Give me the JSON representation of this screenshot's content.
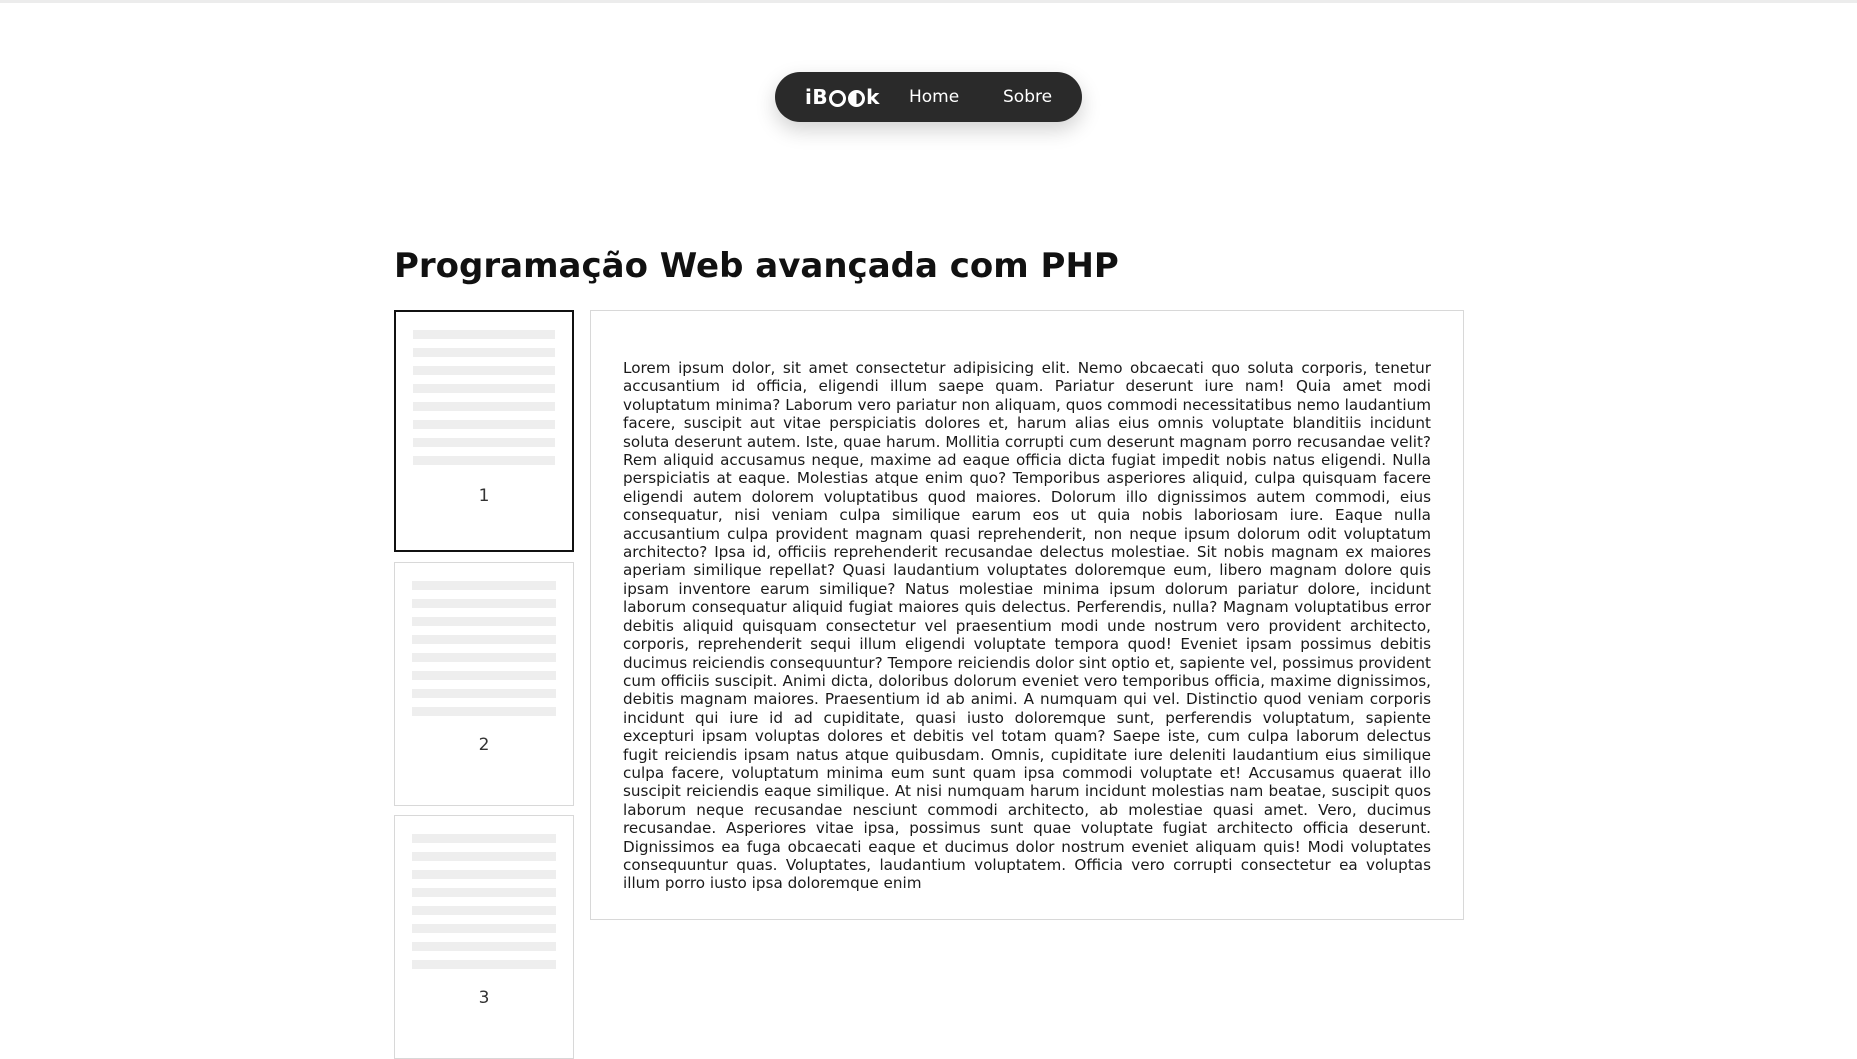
{
  "nav": {
    "brand_prefix": "iB",
    "brand_suffix": "k",
    "items": [
      {
        "label": "Home"
      },
      {
        "label": "Sobre"
      }
    ]
  },
  "book": {
    "title": "Programação Web avançada com PHP"
  },
  "pages": [
    {
      "number": "1",
      "active": true
    },
    {
      "number": "2",
      "active": false
    },
    {
      "number": "3",
      "active": false
    }
  ],
  "reader": {
    "text": "Lorem ipsum dolor, sit amet consectetur adipisicing elit. Nemo obcaecati quo soluta corporis, tenetur accusantium id officia, eligendi illum saepe quam. Pariatur deserunt iure nam! Quia amet modi voluptatum minima? Laborum vero pariatur non aliquam, quos commodi necessitatibus nemo laudantium facere, suscipit aut vitae perspiciatis dolores et, harum alias eius omnis voluptate blanditiis incidunt soluta deserunt autem. Iste, quae harum. Mollitia corrupti cum deserunt magnam porro recusandae velit? Rem aliquid accusamus neque, maxime ad eaque officia dicta fugiat impedit nobis natus eligendi. Nulla perspiciatis at eaque. Molestias atque enim quo? Temporibus asperiores aliquid, culpa quisquam facere eligendi autem dolorem voluptatibus quod maiores. Dolorum illo dignissimos autem commodi, eius consequatur, nisi veniam culpa similique earum eos ut quia nobis laboriosam iure. Eaque nulla accusantium culpa provident magnam quasi reprehenderit, non neque ipsum dolorum odit voluptatum architecto? Ipsa id, officiis reprehenderit recusandae delectus molestiae. Sit nobis magnam ex maiores aperiam similique repellat? Quasi laudantium voluptates doloremque eum, libero magnam dolore quis ipsam inventore earum similique? Natus molestiae minima ipsum dolorum pariatur dolore, incidunt laborum consequatur aliquid fugiat maiores quis delectus. Perferendis, nulla? Magnam voluptatibus error debitis aliquid quisquam consectetur vel praesentium modi unde nostrum vero provident architecto, corporis, reprehenderit sequi illum eligendi voluptate tempora quod! Eveniet ipsam possimus debitis ducimus reiciendis consequuntur? Tempore reiciendis dolor sint optio et, sapiente vel, possimus provident cum officiis suscipit. Animi dicta, doloribus dolorum eveniet vero temporibus officia, maxime dignissimos, debitis magnam maiores. Praesentium id ab animi. A numquam qui vel. Distinctio quod veniam corporis incidunt qui iure id ad cupiditate, quasi iusto doloremque sunt, perferendis voluptatum, sapiente excepturi ipsam voluptas dolores et debitis vel totam quam? Saepe iste, cum culpa laborum delectus fugit reiciendis ipsam natus atque quibusdam. Omnis, cupiditate iure deleniti laudantium eius similique culpa facere, voluptatum minima eum sunt quam ipsa commodi voluptate et! Accusamus quaerat illo suscipit reiciendis eaque similique. At nisi numquam harum incidunt molestias nam beatae, suscipit quos laborum neque recusandae nesciunt commodi architecto, ab molestiae quasi amet. Vero, ducimus recusandae. Asperiores vitae ipsa, possimus sunt quae voluptate fugiat architecto officia deserunt. Dignissimos ea fuga obcaecati eaque et ducimus dolor nostrum eveniet aliquam quis! Modi voluptates consequuntur quas. Voluptates, laudantium voluptatem. Officia vero corrupti consectetur ea voluptas illum porro iusto ipsa doloremque enim"
  }
}
